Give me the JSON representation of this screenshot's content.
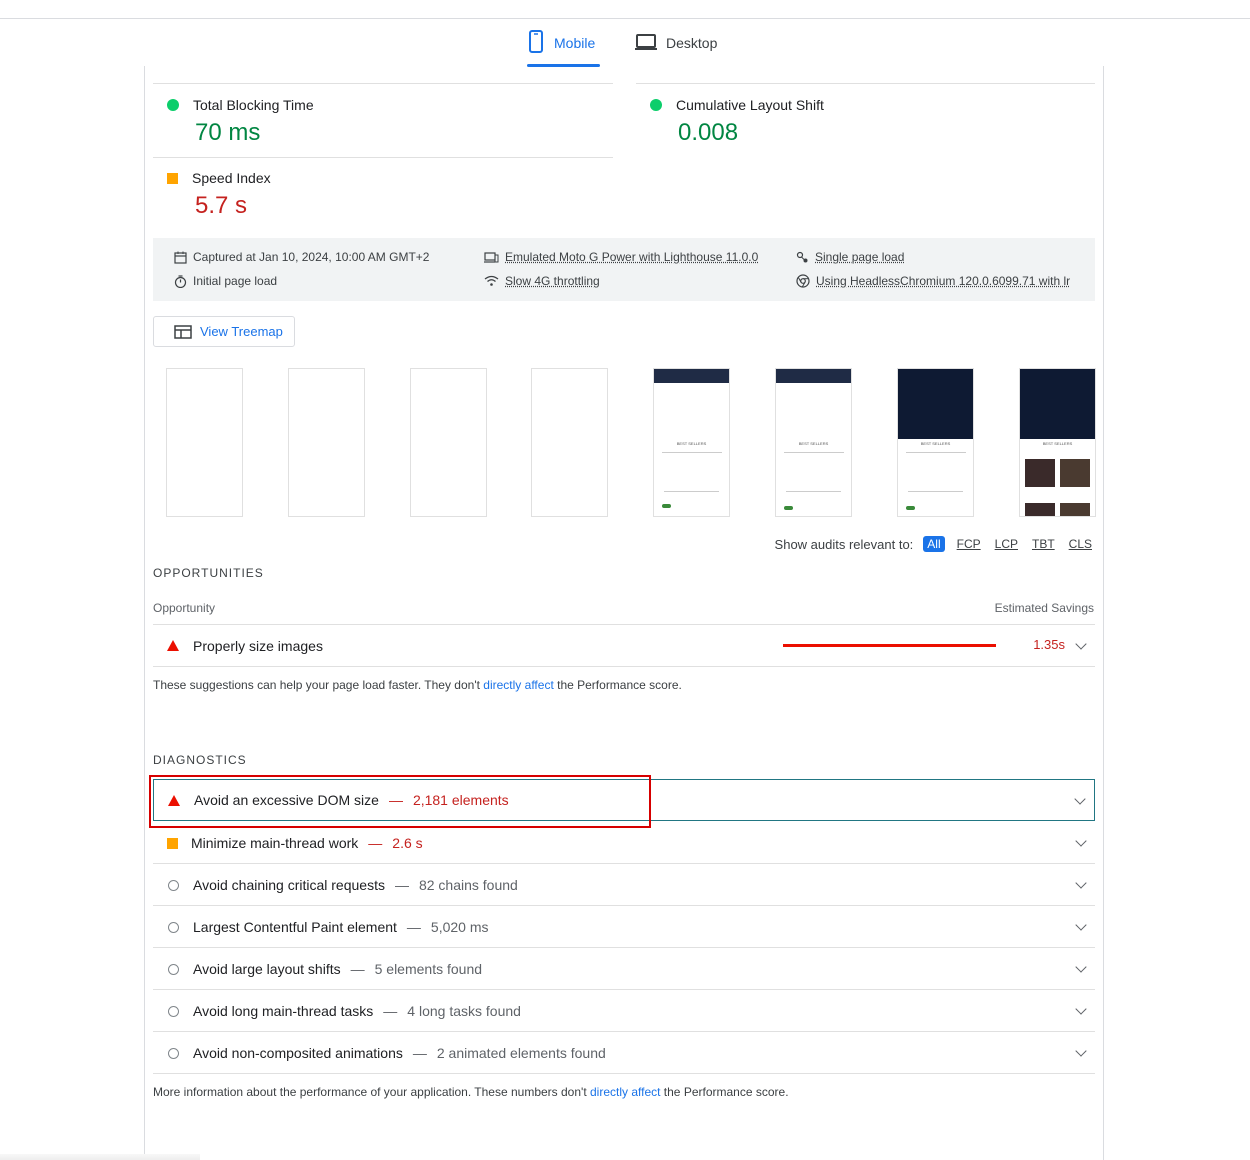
{
  "tabs": [
    {
      "label": "Mobile",
      "icon": "phone-icon",
      "active": true
    },
    {
      "label": "Desktop",
      "icon": "laptop-icon",
      "active": false
    }
  ],
  "metrics": {
    "tbt": {
      "label": "Total Blocking Time",
      "value": "70 ms",
      "status": "pass"
    },
    "cls": {
      "label": "Cumulative Layout Shift",
      "value": "0.008",
      "status": "pass"
    },
    "si": {
      "label": "Speed Index",
      "value": "5.7 s",
      "status": "average"
    }
  },
  "environment": {
    "captured": "Captured at Jan 10, 2024, 10:00 AM GMT+2",
    "initial_load": "Initial page load",
    "device": "Emulated Moto G Power with Lighthouse 11.0.0",
    "throttling": "Slow 4G throttling",
    "single_page": "Single page load",
    "browser": "Using HeadlessChromium 120.0.6099.71 with lr"
  },
  "treemap_label": "View Treemap",
  "filmstrip": {
    "frame_count": 8,
    "frame_title": "BEST SELLERS"
  },
  "filters": {
    "label": "Show audits relevant to:",
    "chips": [
      "All",
      "FCP",
      "LCP",
      "TBT",
      "CLS"
    ],
    "active": "All"
  },
  "opportunities": {
    "title": "OPPORTUNITIES",
    "col_left": "Opportunity",
    "col_right": "Estimated Savings",
    "items": [
      {
        "title": "Properly size images",
        "savings": "1.35s",
        "savings_fraction": 1.0
      }
    ],
    "note_before": "These suggestions can help your page load faster. They don't ",
    "note_link": "directly affect",
    "note_after": " the Performance score."
  },
  "diagnostics": {
    "title": "DIAGNOSTICS",
    "items": [
      {
        "title": "Avoid an excessive DOM size",
        "display": "2,181 elements",
        "severity": "fail"
      },
      {
        "title": "Minimize main-thread work",
        "display": "2.6 s",
        "severity": "average"
      },
      {
        "title": "Avoid chaining critical requests",
        "display": "82 chains found",
        "severity": "info"
      },
      {
        "title": "Largest Contentful Paint element",
        "display": "5,020 ms",
        "severity": "info"
      },
      {
        "title": "Avoid large layout shifts",
        "display": "5 elements found",
        "severity": "info"
      },
      {
        "title": "Avoid long main-thread tasks",
        "display": "4 long tasks found",
        "severity": "info"
      },
      {
        "title": "Avoid non-composited animations",
        "display": "2 animated elements found",
        "severity": "info"
      }
    ],
    "note_before": "More information about the performance of your application. These numbers don't ",
    "note_link": "directly affect",
    "note_after": " the Performance score."
  },
  "colors": {
    "accent": "#1a73e8",
    "pass": "#0cce6b",
    "average": "#ffa400",
    "fail": "#eb0f00",
    "highlight": "#d60000"
  }
}
